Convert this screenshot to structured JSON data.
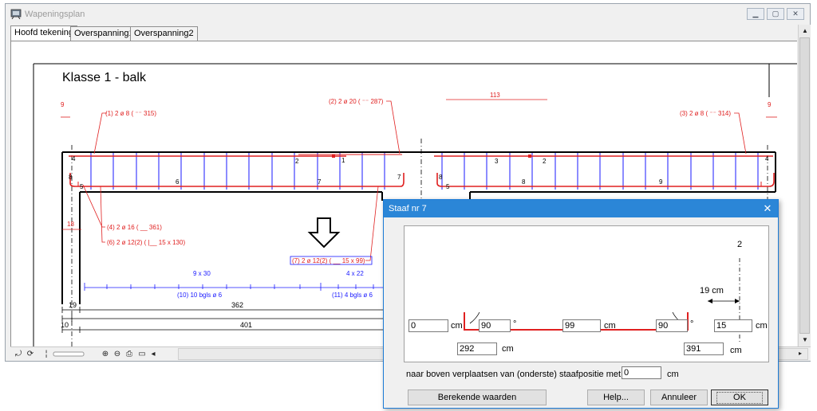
{
  "window": {
    "title": "Wapeningsplan",
    "icon": "drawing-app-icon"
  },
  "tabs": [
    {
      "label": "Hoofd tekening",
      "active": true
    },
    {
      "label": "Overspanning1",
      "active": false
    },
    {
      "label": "Overspanning2",
      "active": false
    }
  ],
  "drawing": {
    "heading": "Klasse 1 -  balk",
    "dim_9_left": "9",
    "dim_9_right": "9",
    "dim_113": "113",
    "bar_label_1": "(1) 2 ø 8 ( ⁻⁻ 315)",
    "bar_label_2": "(2) 2 ø 20 ( ⁻⁻ 287)",
    "bar_label_3": "(3) 2 ø 8 ( ⁻⁻ 314)",
    "bar_label_4": "(4) 2 ø 16 ( __ 361)",
    "bar_label_6": "(6) 2 ø 12(2) ( |__ 15 x 130)",
    "bar_label_7": "(7) 2 ø 12(2) ( __ 15 x 99)",
    "num_1": "1",
    "num_2a": "2",
    "num_2b": "2",
    "num_3": "3",
    "num_4": "4",
    "num_5a": "5",
    "num_5b": "5",
    "num_6": "6",
    "num_7a": "7",
    "num_7b": "7",
    "num_8": "8",
    "num_9": "9",
    "num_8l": "8",
    "num_8r": "8",
    "num_4r": "4",
    "dim_18": "18",
    "stirrup_spacing_1": "9 x 30",
    "stirrup_spacing_2": "4 x 22",
    "stirrup_label_10": "(10) 10 bgls ø 6",
    "stirrup_label_11": "(11) 4 bgls ø 6",
    "dim_19": "19",
    "dim_362": "362",
    "dim_10": "10",
    "dim_401": "401"
  },
  "bottom_toolbar": {
    "tools": [
      "rotate-icon",
      "refresh-icon",
      "marker-icon",
      "slider-icon",
      "zoom-in-icon",
      "zoom-out-icon",
      "print-icon",
      "rectangle-icon",
      "scroll-left-icon"
    ]
  },
  "dialog": {
    "title": "Staaf nr 7",
    "close": "✕",
    "schematic": {
      "label_2": "2",
      "label_19cm": "19  cm"
    },
    "fields": {
      "left_len": "0",
      "left_angle": "90",
      "mid_len": "99",
      "right_angle": "90",
      "right_len": "15",
      "left_pos": "292",
      "right_pos": "391"
    },
    "units": {
      "cm": "cm",
      "deg": "°"
    },
    "shift_label": "naar boven verplaatsen van (onderste) staafpositie met",
    "shift_value": "0",
    "shift_unit": "cm",
    "buttons": {
      "computed": "Berekende waarden",
      "help": "Help...",
      "cancel": "Annuleer",
      "ok": "OK"
    }
  },
  "colors": {
    "rebar": "#e02020",
    "stirrup": "#1a1aff",
    "dialog_title": "#2b86d7"
  }
}
